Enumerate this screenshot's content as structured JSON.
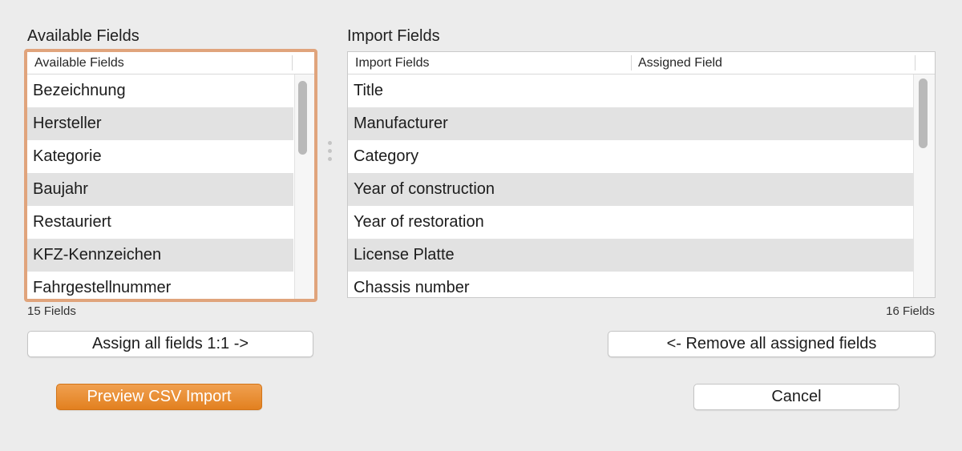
{
  "available": {
    "title": "Available Fields",
    "column_header": "Available Fields",
    "rows": [
      "Bezeichnung",
      "Hersteller",
      "Kategorie",
      "Baujahr",
      "Restauriert",
      "KFZ-Kennzeichen",
      "Fahrgestellnummer"
    ],
    "count": "15 Fields"
  },
  "import": {
    "title": "Import Fields",
    "columns": [
      "Import Fields",
      "Assigned Field"
    ],
    "rows": [
      "Title",
      "Manufacturer",
      "Category",
      "Year of construction",
      "Year of restoration",
      "License Platte",
      "Chassis number"
    ],
    "count": "16 Fields"
  },
  "buttons": {
    "assign_all": "Assign all fields 1:1 ->",
    "remove_all": "<- Remove all assigned fields",
    "preview": "Preview CSV Import",
    "cancel": "Cancel"
  },
  "colors": {
    "focus_ring": "#e0a47c",
    "primary_button": "#e88a2e",
    "alt_row": "#e2e2e2",
    "background": "#ececec"
  }
}
